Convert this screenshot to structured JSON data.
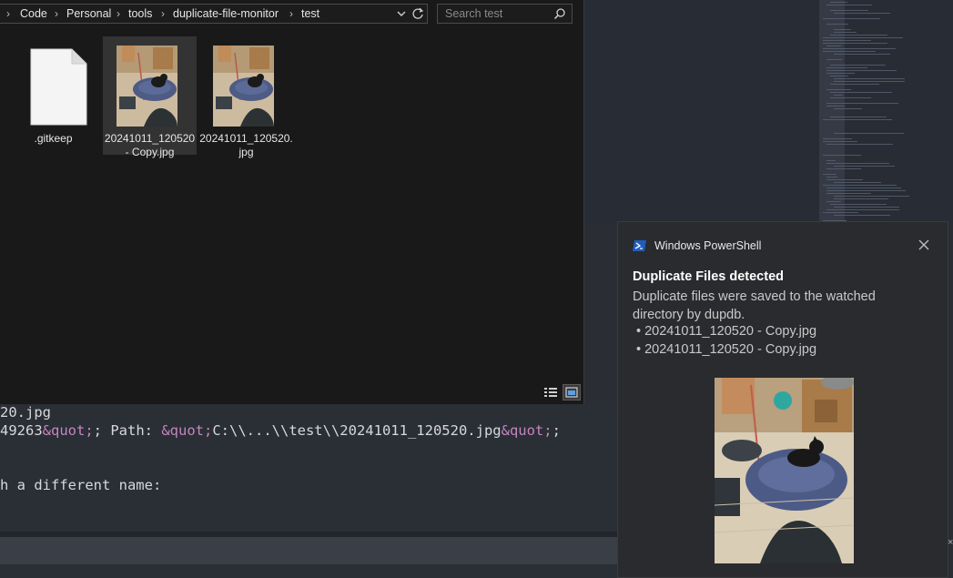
{
  "explorer": {
    "breadcrumbs": [
      "Code",
      "Personal",
      "tools",
      "duplicate-file-monitor",
      "test"
    ],
    "search_placeholder": "Search test",
    "files": [
      {
        "name_line1": ".gitkeep",
        "name_line2": "",
        "type": "document"
      },
      {
        "name_line1": "20241011_120520",
        "name_line2": "- Copy.jpg",
        "type": "image",
        "selected": true
      },
      {
        "name_line1": "20241011_120520.",
        "name_line2": "jpg",
        "type": "image"
      }
    ]
  },
  "terminal": {
    "line1": "20.jpg",
    "line2_a": "49263",
    "line2_b": "&quot;",
    "line2_c": "; Path: ",
    "line2_d": "&quot;",
    "line2_e": "C:\\\\...\\\\test\\\\20241011_120520.jpg",
    "line2_f": "&quot;",
    "line2_g": ";",
    "line3": "h a different name:"
  },
  "toast": {
    "app_name": "Windows PowerShell",
    "title": "Duplicate Files detected",
    "body": "Duplicate files were saved to the watched directory by dupdb.",
    "items": [
      "• 20241011_120520 - Copy.jpg",
      "• 20241011_120520 - Copy.jpg"
    ]
  },
  "colors": {
    "explorer_bg": "#191919",
    "terminal_bg": "#2a2e35",
    "entity": "#c586c0",
    "toast_bg": "#2a2b2e",
    "powershell_blue": "#1f5dbb"
  },
  "icons": [
    "chevron-down-icon",
    "refresh-icon",
    "search-icon",
    "document-icon",
    "details-view-icon",
    "large-icons-view-icon",
    "powershell-icon",
    "close-icon"
  ]
}
